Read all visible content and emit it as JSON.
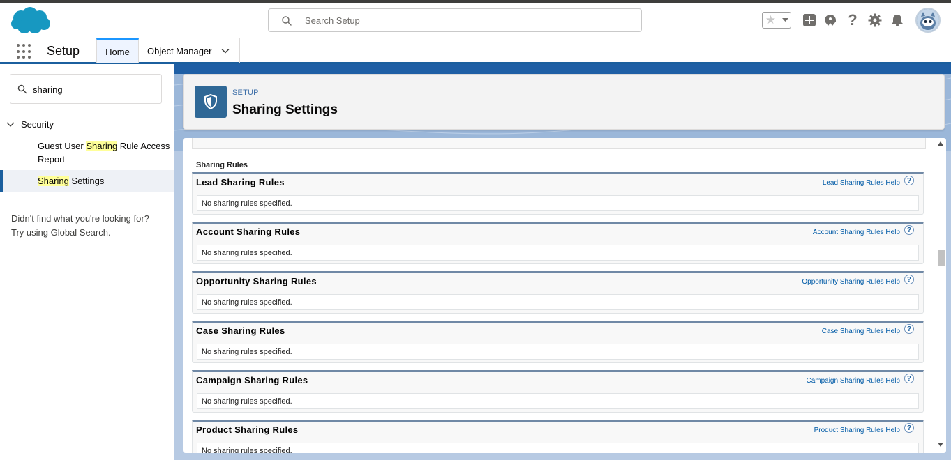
{
  "header": {
    "search_placeholder": "Search Setup",
    "favorites_icon": "star-icon",
    "icons": [
      "add-icon",
      "trailhead-icon",
      "help-icon",
      "setup-gear-icon",
      "notification-bell-icon",
      "user-avatar"
    ]
  },
  "nav": {
    "app_name": "Setup",
    "tabs": [
      {
        "label": "Home",
        "active": true
      },
      {
        "label": "Object Manager",
        "active": false
      }
    ]
  },
  "sidebar": {
    "quickfind_value": "sharing",
    "tree": {
      "parent_label": "Security",
      "items": [
        {
          "before": "Guest User ",
          "highlight": "Sharing",
          "after": " Rule Access Report",
          "selected": false
        },
        {
          "before": "",
          "highlight": "Sharing",
          "after": " Settings",
          "selected": true
        }
      ]
    },
    "no_result_line1": "Didn't find what you're looking for?",
    "no_result_line2": "Try using Global Search."
  },
  "page_header": {
    "eyebrow": "SETUP",
    "title": "Sharing Settings"
  },
  "content": {
    "section_title": "Sharing Rules",
    "empty_text": "No sharing rules specified.",
    "rule_blocks": [
      {
        "title": "Lead Sharing Rules",
        "help": "Lead Sharing Rules Help"
      },
      {
        "title": "Account Sharing Rules",
        "help": "Account Sharing Rules Help"
      },
      {
        "title": "Opportunity Sharing Rules",
        "help": "Opportunity Sharing Rules Help"
      },
      {
        "title": "Case Sharing Rules",
        "help": "Case Sharing Rules Help"
      },
      {
        "title": "Campaign Sharing Rules",
        "help": "Campaign Sharing Rules Help"
      },
      {
        "title": "Product Sharing Rules",
        "help": "Product Sharing Rules Help"
      }
    ]
  },
  "colors": {
    "brand_blue": "#1b96ff",
    "header_icon_bg": "#2f6896",
    "highlight": "#ffff99",
    "link": "#015ba7"
  }
}
